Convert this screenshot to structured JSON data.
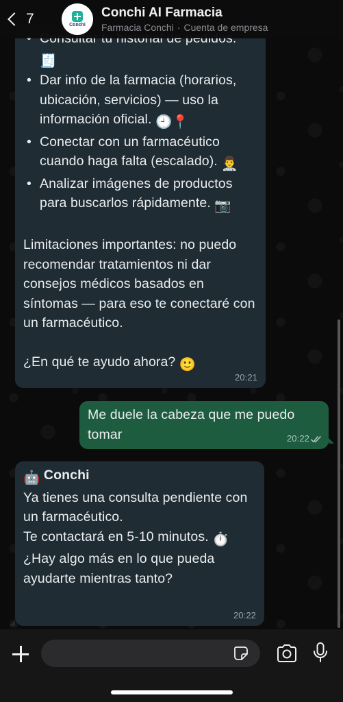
{
  "header": {
    "back_count": "7",
    "avatar_text": "Conchi",
    "contact_name": "Conchi AI Farmacia",
    "contact_subtitle_1": "Farmacia Conchi",
    "contact_subtitle_2": "Cuenta de empresa"
  },
  "messages": [
    {
      "direction": "incoming",
      "bullets": [
        {
          "text": "Consultar tu historial de pedidos.",
          "emoji": "🧾"
        },
        {
          "text": "Dar info de la farmacia (horarios, ubicación, servicios) — uso la información oficial.",
          "emoji": "🕘📍"
        },
        {
          "text": "Conectar con un farmacéutico cuando haga falta (escalado).",
          "emoji": "👨‍⚕️"
        },
        {
          "text": "Analizar imágenes de productos para buscarlos rápidamente.",
          "emoji": "📷"
        }
      ],
      "limitations": "Limitaciones importantes: no puedo recomendar tratamientos ni dar consejos médicos basados en síntomas — para eso te conectaré con un farmacéutico.",
      "question": "¿En qué te ayudo ahora?",
      "question_emoji": "🙂",
      "time": "20:21"
    },
    {
      "direction": "outgoing",
      "text": "Me duele la cabeza que me puedo tomar",
      "time": "20:22",
      "status": "read"
    },
    {
      "direction": "incoming",
      "sender_emoji": "🤖",
      "sender": "Conchi",
      "line1": "Ya tienes una consulta pendiente con un farmacéutico.",
      "line2": "Te contactará en 5-10 minutos.",
      "line2_emoji": "⏱️",
      "line3": "¿Hay algo más en lo que pueda ayudarte mientras tanto?",
      "time": "20:22"
    }
  ],
  "composer": {
    "placeholder": ""
  },
  "colors": {
    "incoming_bubble": "#202c33",
    "outgoing_bubble": "#1e5c3f",
    "read_ticks": "#a9c7b7",
    "brand": "#1fb29b"
  },
  "icons": [
    "back-chevron-icon",
    "plus-icon",
    "sticker-icon",
    "camera-icon",
    "microphone-icon",
    "double-check-icon"
  ]
}
